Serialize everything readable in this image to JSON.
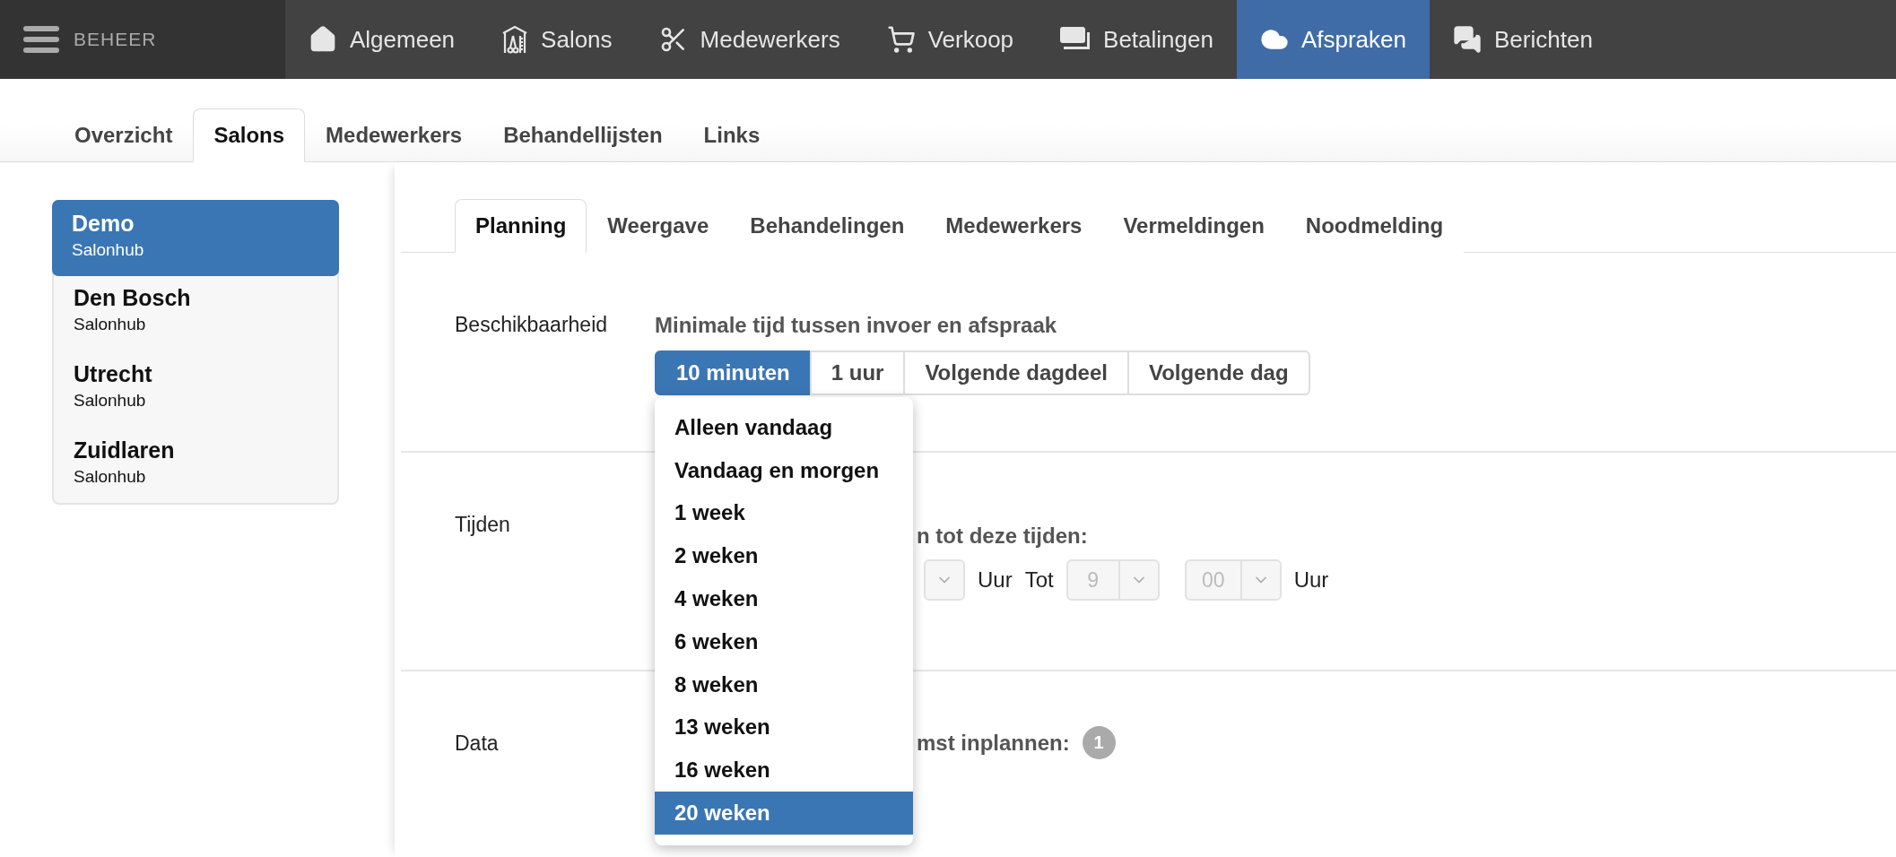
{
  "app": {
    "title": "BEHEER"
  },
  "nav": [
    {
      "label": "Algemeen",
      "selected": false
    },
    {
      "label": "Salons",
      "selected": false
    },
    {
      "label": "Medewerkers",
      "selected": false
    },
    {
      "label": "Verkoop",
      "selected": false
    },
    {
      "label": "Betalingen",
      "selected": false
    },
    {
      "label": "Afspraken",
      "selected": true
    },
    {
      "label": "Berichten",
      "selected": false
    }
  ],
  "subtabs": [
    {
      "label": "Overzicht",
      "selected": false
    },
    {
      "label": "Salons",
      "selected": true
    },
    {
      "label": "Medewerkers",
      "selected": false
    },
    {
      "label": "Behandellijsten",
      "selected": false
    },
    {
      "label": "Links",
      "selected": false
    }
  ],
  "salons": [
    {
      "name": "Demo",
      "subtitle": "Salonhub",
      "selected": true
    },
    {
      "name": "Den Bosch",
      "subtitle": "Salonhub",
      "selected": false
    },
    {
      "name": "Utrecht",
      "subtitle": "Salonhub",
      "selected": false
    },
    {
      "name": "Zuidlaren",
      "subtitle": "Salonhub",
      "selected": false
    }
  ],
  "section_tabs": [
    {
      "label": "Planning",
      "selected": true
    },
    {
      "label": "Weergave",
      "selected": false
    },
    {
      "label": "Behandelingen",
      "selected": false
    },
    {
      "label": "Medewerkers",
      "selected": false
    },
    {
      "label": "Vermeldingen",
      "selected": false
    },
    {
      "label": "Noodmelding",
      "selected": false
    }
  ],
  "availability": {
    "label": "Beschikbaarheid",
    "question": "Minimale tijd tussen invoer en afspraak",
    "options": [
      {
        "label": "10 minuten",
        "selected": true
      },
      {
        "label": "1 uur",
        "selected": false
      },
      {
        "label": "Volgende dagdeel",
        "selected": false
      },
      {
        "label": "Volgende dag",
        "selected": false
      }
    ]
  },
  "times": {
    "label": "Tijden",
    "prompt": "n tot deze tijden:",
    "disabled": true,
    "from_suffix": "Uur",
    "to_label": "Tot",
    "to_hour": "9",
    "to_minute": "00",
    "to_suffix": "Uur"
  },
  "data": {
    "label": "Data",
    "prompt": "mst inplannen:",
    "badge": "1"
  },
  "dropdown": {
    "items": [
      {
        "label": "Alleen vandaag",
        "selected": false
      },
      {
        "label": "Vandaag en morgen",
        "selected": false
      },
      {
        "label": "1 week",
        "selected": false
      },
      {
        "label": "2 weken",
        "selected": false
      },
      {
        "label": "4 weken",
        "selected": false
      },
      {
        "label": "6 weken",
        "selected": false
      },
      {
        "label": "8 weken",
        "selected": false
      },
      {
        "label": "13 weken",
        "selected": false
      },
      {
        "label": "16 weken",
        "selected": false
      },
      {
        "label": "20 weken",
        "selected": true
      }
    ]
  }
}
